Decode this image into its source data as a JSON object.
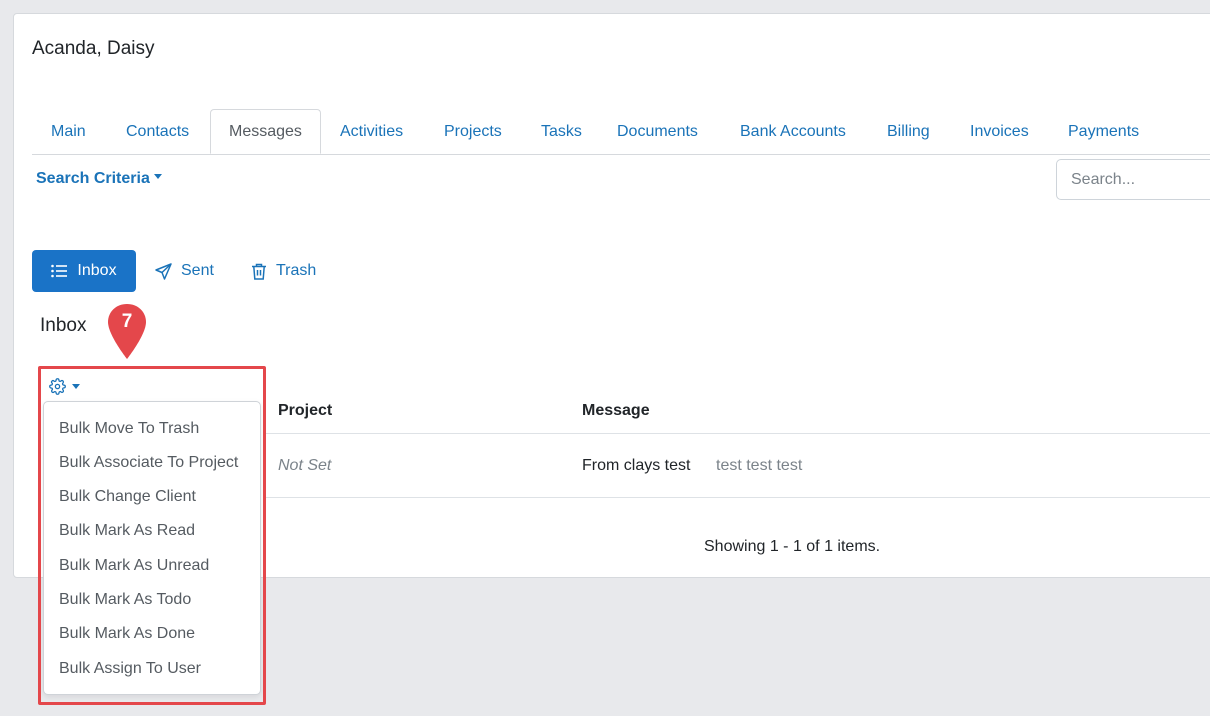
{
  "client": {
    "name": "Acanda, Daisy"
  },
  "tabs": [
    {
      "label": "Main"
    },
    {
      "label": "Contacts"
    },
    {
      "label": "Messages",
      "active": true
    },
    {
      "label": "Activities"
    },
    {
      "label": "Projects"
    },
    {
      "label": "Tasks"
    },
    {
      "label": "Documents"
    },
    {
      "label": "Bank Accounts"
    },
    {
      "label": "Billing"
    },
    {
      "label": "Invoices"
    },
    {
      "label": "Payments"
    }
  ],
  "search": {
    "criteria_label": "Search Criteria",
    "placeholder": "Search..."
  },
  "folders": {
    "inbox": "Inbox",
    "sent": "Sent",
    "trash": "Trash"
  },
  "section": {
    "title": "Inbox"
  },
  "table": {
    "columns": [
      "Project",
      "Message"
    ],
    "rows": [
      {
        "project": "Not Set",
        "subject": "From clays test",
        "preview": "test test test"
      }
    ],
    "footer": "Showing 1 - 1 of 1 items."
  },
  "bulk_menu": {
    "items": [
      "Bulk Move To Trash",
      "Bulk Associate To Project",
      "Bulk Change Client",
      "Bulk Mark As Read",
      "Bulk Mark As Unread",
      "Bulk Mark As Todo",
      "Bulk Mark As Done",
      "Bulk Assign To User"
    ]
  },
  "annotation": {
    "step_number": "7",
    "color": "#e4474b"
  },
  "colors": {
    "accent": "#1a73b8",
    "primary_button": "#1a73c7",
    "page_background": "#e8e9ec"
  },
  "icons": {
    "inbox": "list-icon",
    "sent": "paper-plane-icon",
    "trash": "trash-icon",
    "bulk": "gear-icon"
  }
}
